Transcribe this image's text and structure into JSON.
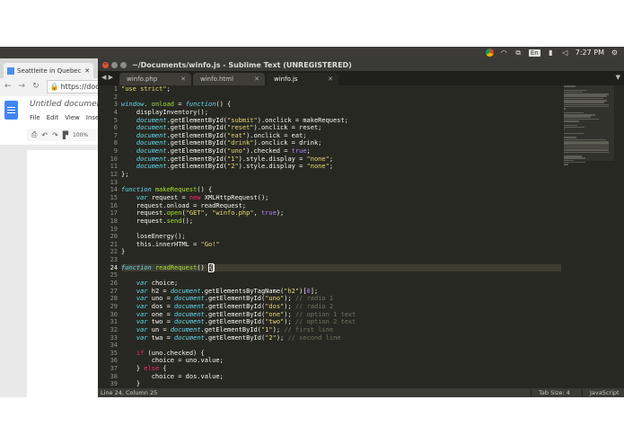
{
  "system_bar": {
    "language": "En",
    "time": "7:27 PM"
  },
  "chrome": {
    "tab_title": "Seattleite in Quebec",
    "url": "https://docs.",
    "doc_title": "Untitled document",
    "menu": [
      "File",
      "Edit",
      "View",
      "Insert"
    ],
    "zoom": "100%"
  },
  "sublime": {
    "title": "~/Documents/winfo.js - Sublime Text (UNREGISTERED)",
    "tabs": [
      {
        "label": "winfo.php",
        "active": false
      },
      {
        "label": "winfo.html",
        "active": false
      },
      {
        "label": "winfo.js",
        "active": true
      }
    ],
    "status_position": "Line 24, Column 25",
    "status_tab_size": "Tab Size: 4",
    "status_syntax": "JavaScript",
    "current_line": 24,
    "line_numbers": [
      "1",
      "2",
      "3",
      "4",
      "5",
      "6",
      "7",
      "8",
      "9",
      "10",
      "11",
      "12",
      "13",
      "14",
      "15",
      "16",
      "17",
      "18",
      "19",
      "20",
      "21",
      "22",
      "23",
      "24",
      "25",
      "26",
      "27",
      "28",
      "29",
      "30",
      "31",
      "32",
      "33",
      "34",
      "35",
      "36",
      "37",
      "38",
      "39"
    ],
    "code": [
      [
        [
          "s",
          "\"use strict\""
        ],
        [
          "",
          "; "
        ]
      ],
      [],
      [
        [
          "b",
          "window"
        ],
        [
          "",
          ". "
        ],
        [
          "f",
          "onload"
        ],
        [
          "",
          " = "
        ],
        [
          "b",
          "function"
        ],
        [
          "",
          "() {"
        ]
      ],
      [
        [
          "",
          "    displayInventory();"
        ]
      ],
      [
        [
          "",
          "    "
        ],
        [
          "b",
          "document"
        ],
        [
          "",
          ".getElementById("
        ],
        [
          "s",
          "\"submit\""
        ],
        [
          "",
          ").onclick = makeRequest;"
        ]
      ],
      [
        [
          "",
          "    "
        ],
        [
          "b",
          "document"
        ],
        [
          "",
          ".getElementById("
        ],
        [
          "s",
          "\"reset\""
        ],
        [
          "",
          ").onclick = reset;"
        ]
      ],
      [
        [
          "",
          "    "
        ],
        [
          "b",
          "document"
        ],
        [
          "",
          ".getElementById("
        ],
        [
          "s",
          "\"eat\""
        ],
        [
          "",
          ").onclick = eat;"
        ]
      ],
      [
        [
          "",
          "    "
        ],
        [
          "b",
          "document"
        ],
        [
          "",
          ".getElementById("
        ],
        [
          "s",
          "\"drink\""
        ],
        [
          "",
          ").onclick = drink;"
        ]
      ],
      [
        [
          "",
          "    "
        ],
        [
          "b",
          "document"
        ],
        [
          "",
          ".getElementById("
        ],
        [
          "s",
          "\"uno\""
        ],
        [
          "",
          ").checked = "
        ],
        [
          "n",
          "true"
        ],
        [
          "",
          ";"
        ]
      ],
      [
        [
          "",
          "    "
        ],
        [
          "b",
          "document"
        ],
        [
          "",
          ".getElementById("
        ],
        [
          "s",
          "\"1\""
        ],
        [
          "",
          ").style.display = "
        ],
        [
          "s",
          "\"none\""
        ],
        [
          "",
          ";"
        ]
      ],
      [
        [
          "",
          "    "
        ],
        [
          "b",
          "document"
        ],
        [
          "",
          ".getElementById("
        ],
        [
          "s",
          "\"2\""
        ],
        [
          "",
          ").style.display = "
        ],
        [
          "s",
          "\"none\""
        ],
        [
          "",
          ";"
        ]
      ],
      [
        [
          "",
          "};"
        ]
      ],
      [],
      [
        [
          "b",
          "function"
        ],
        [
          "",
          " "
        ],
        [
          "f",
          "makeRequest"
        ],
        [
          "",
          "() {"
        ]
      ],
      [
        [
          "",
          "    "
        ],
        [
          "b",
          "var"
        ],
        [
          "",
          " request = "
        ],
        [
          "k",
          "new"
        ],
        [
          "",
          " XMLHttpRequest();"
        ]
      ],
      [
        [
          "",
          "    request.onload = readRequest;"
        ]
      ],
      [
        [
          "",
          "    request."
        ],
        [
          "f",
          "open"
        ],
        [
          "",
          "("
        ],
        [
          "s",
          "\"GET\""
        ],
        [
          "",
          ", "
        ],
        [
          "s",
          "\"winfo.php\""
        ],
        [
          "",
          ", "
        ],
        [
          "n",
          "true"
        ],
        [
          "",
          ");"
        ]
      ],
      [
        [
          "",
          "    request."
        ],
        [
          "f",
          "send"
        ],
        [
          "",
          "();"
        ]
      ],
      [],
      [
        [
          "",
          "    loseEnergy();"
        ]
      ],
      [
        [
          "",
          "    this.innerHTML = "
        ],
        [
          "s",
          "\"Go!\""
        ]
      ],
      [
        [
          "",
          "}"
        ]
      ],
      [],
      [
        [
          "b",
          "function"
        ],
        [
          "",
          " "
        ],
        [
          "f",
          "readRequest"
        ],
        [
          "",
          "() "
        ],
        [
          "cursor",
          "{"
        ]
      ],
      [],
      [
        [
          "",
          "    "
        ],
        [
          "b",
          "var"
        ],
        [
          "",
          " choice;"
        ]
      ],
      [
        [
          "",
          "    "
        ],
        [
          "b",
          "var"
        ],
        [
          "",
          " h2 = "
        ],
        [
          "b",
          "document"
        ],
        [
          "",
          ".getElementsByTagName("
        ],
        [
          "s",
          "\"h2\""
        ],
        [
          "",
          ")["
        ],
        [
          "n",
          "0"
        ],
        [
          "",
          "];"
        ]
      ],
      [
        [
          "",
          "    "
        ],
        [
          "b",
          "var"
        ],
        [
          "",
          " uno = "
        ],
        [
          "b",
          "document"
        ],
        [
          "",
          ".getElementById("
        ],
        [
          "s",
          "\"uno\""
        ],
        [
          "",
          "); "
        ],
        [
          "c",
          "// radio 1"
        ]
      ],
      [
        [
          "",
          "    "
        ],
        [
          "b",
          "var"
        ],
        [
          "",
          " dos = "
        ],
        [
          "b",
          "document"
        ],
        [
          "",
          ".getElementById("
        ],
        [
          "s",
          "\"dos\""
        ],
        [
          "",
          "); "
        ],
        [
          "c",
          "// radio 2"
        ]
      ],
      [
        [
          "",
          "    "
        ],
        [
          "b",
          "var"
        ],
        [
          "",
          " one = "
        ],
        [
          "b",
          "document"
        ],
        [
          "",
          ".getElementById("
        ],
        [
          "s",
          "\"one\""
        ],
        [
          "",
          "); "
        ],
        [
          "c",
          "// option 1 text"
        ]
      ],
      [
        [
          "",
          "    "
        ],
        [
          "b",
          "var"
        ],
        [
          "",
          " two = "
        ],
        [
          "b",
          "document"
        ],
        [
          "",
          ".getElementById("
        ],
        [
          "s",
          "\"two\""
        ],
        [
          "",
          "); "
        ],
        [
          "c",
          "// option 2 text"
        ]
      ],
      [
        [
          "",
          "    "
        ],
        [
          "b",
          "var"
        ],
        [
          "",
          " un = "
        ],
        [
          "b",
          "document"
        ],
        [
          "",
          ".getElementById("
        ],
        [
          "s",
          "\"1\""
        ],
        [
          "",
          "); "
        ],
        [
          "c",
          "// first line"
        ]
      ],
      [
        [
          "",
          "    "
        ],
        [
          "b",
          "var"
        ],
        [
          "",
          " twa = "
        ],
        [
          "b",
          "document"
        ],
        [
          "",
          ".getElementById("
        ],
        [
          "s",
          "\"2\""
        ],
        [
          "",
          "); "
        ],
        [
          "c",
          "// second line"
        ]
      ],
      [],
      [
        [
          "",
          "    "
        ],
        [
          "k",
          "if"
        ],
        [
          "",
          " (uno.checked) {"
        ]
      ],
      [
        [
          "",
          "        choice = uno.value;"
        ]
      ],
      [
        [
          "",
          "    } "
        ],
        [
          "k",
          "else"
        ],
        [
          "",
          " {"
        ]
      ],
      [
        [
          "",
          "        choice = dos.value;"
        ]
      ],
      [
        [
          "",
          "    }"
        ]
      ]
    ]
  }
}
